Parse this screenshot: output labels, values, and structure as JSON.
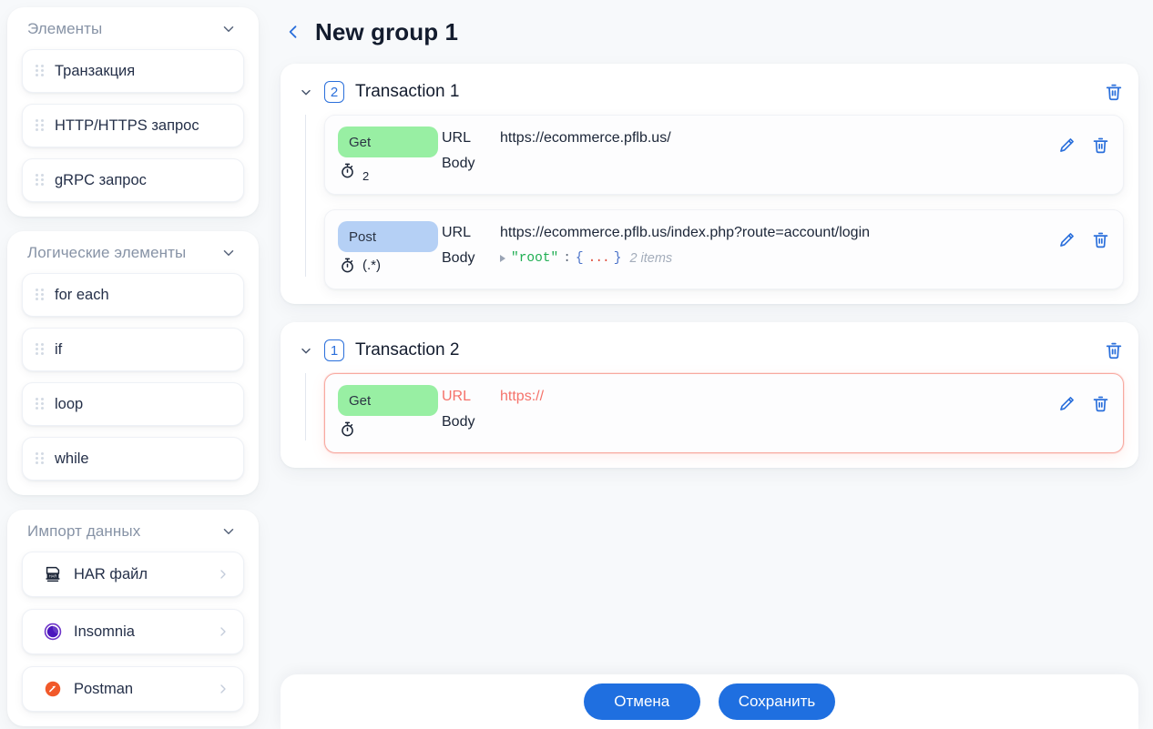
{
  "sidebar": {
    "sections": [
      {
        "title": "Элементы",
        "chevron_icon": "chevron-down-icon",
        "items": [
          {
            "label": "Транзакция"
          },
          {
            "label": "HTTP/HTTPS запрос"
          },
          {
            "label": "gRPC запрос"
          }
        ]
      },
      {
        "title": "Логические элементы",
        "chevron_icon": "chevron-down-icon",
        "items": [
          {
            "label": "for each"
          },
          {
            "label": "if"
          },
          {
            "label": "loop"
          },
          {
            "label": "while"
          }
        ]
      }
    ],
    "import": {
      "title": "Импорт данных",
      "chevron_icon": "chevron-down-icon",
      "items": [
        {
          "label": "HAR файл",
          "icon": "har-file-icon",
          "badge_text": "HAR"
        },
        {
          "label": "Insomnia",
          "icon": "insomnia-icon"
        },
        {
          "label": "Postman",
          "icon": "postman-icon"
        }
      ]
    }
  },
  "header": {
    "back_icon": "chevron-left-icon",
    "title": "New group 1"
  },
  "transactions": [
    {
      "name": "Transaction 1",
      "count": "2",
      "delete_icon": "trash-icon",
      "requests": [
        {
          "method": "Get",
          "method_style": "get",
          "timing_icon": "stopwatch-icon",
          "timing_value": "2",
          "timing_style": "sub",
          "url_label": "URL",
          "url": "https://ecommerce.pflb.us/",
          "body_label": "Body",
          "body": null,
          "edit_icon": "pencil-icon",
          "delete_icon": "trash-icon",
          "error": false
        },
        {
          "method": "Post",
          "method_style": "post",
          "timing_icon": "stopwatch-icon",
          "timing_value": "(.*)",
          "timing_style": "re",
          "url_label": "URL",
          "url": "https://ecommerce.pflb.us/index.php?route=account/login",
          "body_label": "Body",
          "body": {
            "key": "\"root\"",
            "colon": ":",
            "open_brace": "{",
            "dots": "...",
            "close_brace": "}",
            "count": "2 items"
          },
          "edit_icon": "pencil-icon",
          "delete_icon": "trash-icon",
          "error": false
        }
      ]
    },
    {
      "name": "Transaction 2",
      "count": "1",
      "delete_icon": "trash-icon",
      "requests": [
        {
          "method": "Get",
          "method_style": "get",
          "timing_icon": "stopwatch-icon",
          "timing_value": "",
          "timing_style": "sub",
          "url_label": "URL",
          "url": "https://",
          "body_label": "Body",
          "body": null,
          "edit_icon": "pencil-icon",
          "delete_icon": "trash-icon",
          "error": true
        }
      ]
    }
  ],
  "footer": {
    "cancel_label": "Отмена",
    "save_label": "Сохранить"
  },
  "colors": {
    "accent": "#1f6fe0",
    "get_badge": "#98efa3",
    "post_badge": "#b5d0f5",
    "error": "#f5726a",
    "json_key": "#1fae52",
    "page_bg": "#f7f9fb"
  }
}
